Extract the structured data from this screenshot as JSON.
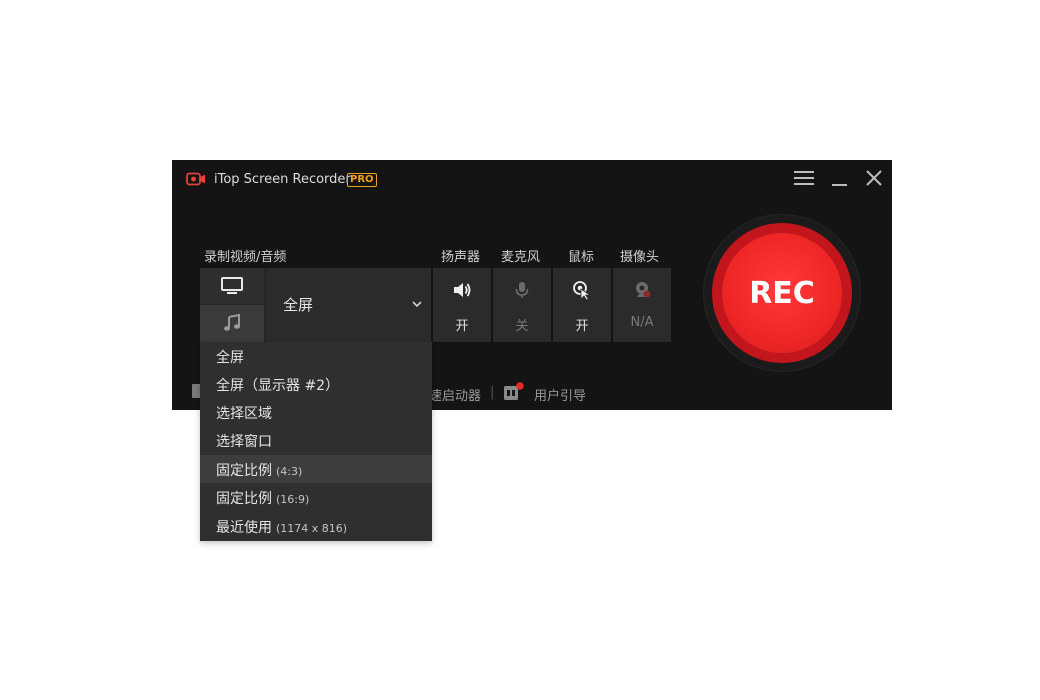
{
  "app": {
    "title": "iTop Screen Recorder",
    "badge": "PRO"
  },
  "recorder": {
    "mode_label": "录制视频/音频",
    "selected_mode": "全屏"
  },
  "devices": [
    {
      "label": "扬声器",
      "state": "开",
      "icon": "speaker-icon"
    },
    {
      "label": "麦克风",
      "state": "关",
      "icon": "microphone-icon"
    },
    {
      "label": "鼠标",
      "state": "开",
      "icon": "mouse-cursor-icon"
    },
    {
      "label": "摄像头",
      "state": "N/A",
      "icon": "webcam-icon"
    }
  ],
  "rec_button": "REC",
  "bottom": {
    "item1": "速启动器",
    "separator": "|",
    "item2": "用户引导"
  },
  "dropdown": [
    {
      "label": "全屏",
      "sub": ""
    },
    {
      "label": "全屏（显示器 #2）",
      "sub": ""
    },
    {
      "label": "选择区域",
      "sub": ""
    },
    {
      "label": "选择窗口",
      "sub": ""
    },
    {
      "label": "固定比例",
      "sub": "(4:3)"
    },
    {
      "label": "固定比例",
      "sub": "(16:9)"
    },
    {
      "label": "最近使用",
      "sub": "(1174 x 816)"
    }
  ],
  "colors": {
    "accent": "#ee2626",
    "pro_badge": "#f0a020",
    "background": "#141414"
  }
}
